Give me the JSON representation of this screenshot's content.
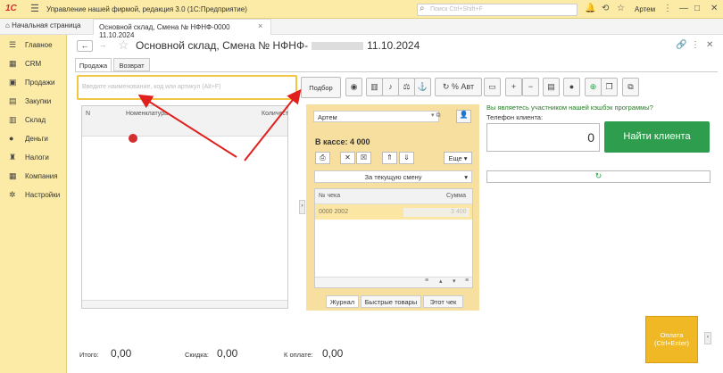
{
  "topbar": {
    "logo": "1С",
    "app_title": "Управление нашей фирмой, редакция 3.0  (1С:Предприятие)",
    "search_placeholder": "Поиск Ctrl+Shift+F",
    "user_name": "Артем"
  },
  "tabs": {
    "home": "Начальная страница",
    "document": "Основной склад, Смена № НФНФ-0000 11.10.2024"
  },
  "sidebar": {
    "items": [
      {
        "label": "Главное",
        "icon": "list-icon"
      },
      {
        "label": "CRM",
        "icon": "crm-icon"
      },
      {
        "label": "Продажи",
        "icon": "cart-icon"
      },
      {
        "label": "Закупки",
        "icon": "purchase-icon"
      },
      {
        "label": "Склад",
        "icon": "warehouse-icon"
      },
      {
        "label": "Деньги",
        "icon": "money-icon"
      },
      {
        "label": "Налоги",
        "icon": "tax-icon"
      },
      {
        "label": "Компания",
        "icon": "company-icon"
      },
      {
        "label": "Настройки",
        "icon": "settings-icon"
      }
    ]
  },
  "header": {
    "title": "Основной склад, Смена № НФНФ-",
    "title_date": "11.10.2024"
  },
  "form_tabs": {
    "sale": "Продажа",
    "return": "Возврат"
  },
  "barcode": {
    "placeholder": "Введите наименование, код или артикул (Alt+F)"
  },
  "toolbar": {
    "podbor": "Подбор",
    "auto": "% Авт",
    "plus": "+",
    "minus": "−"
  },
  "goods_table": {
    "columns": [
      "N",
      "Номенклатура",
      "Количест"
    ]
  },
  "cash_panel": {
    "cashier": "Артем",
    "cash_label": "В кассе: 4 000",
    "more": "Еще",
    "period": "За текущую смену",
    "checks_columns": [
      "№ чека",
      "Сумма"
    ],
    "check_row": {
      "number": "0000 2002",
      "sum": "3 400"
    },
    "subtabs": [
      "Журнал",
      "Быстрые товары",
      "Этот чек"
    ]
  },
  "client": {
    "cashback_question": "Вы являетесь участником нашей кэшбэк программы?",
    "phone_label": "Телефон клиента:",
    "phone_value": "0",
    "find_button": "Найти клиента"
  },
  "footer": {
    "total_label": "Итого:",
    "total_value": "0,00",
    "discount_label": "Скидка:",
    "discount_value": "0,00",
    "to_pay_label": "К оплате:",
    "to_pay_value": "0,00",
    "pay_button_line1": "Оплата",
    "pay_button_line2": "(Ctrl+Enter)"
  },
  "colors": {
    "accent": "#fbeba6",
    "find_button": "#2e9e4e",
    "pay_button": "#f0b824",
    "annotation_arrow": "#e0201c"
  }
}
